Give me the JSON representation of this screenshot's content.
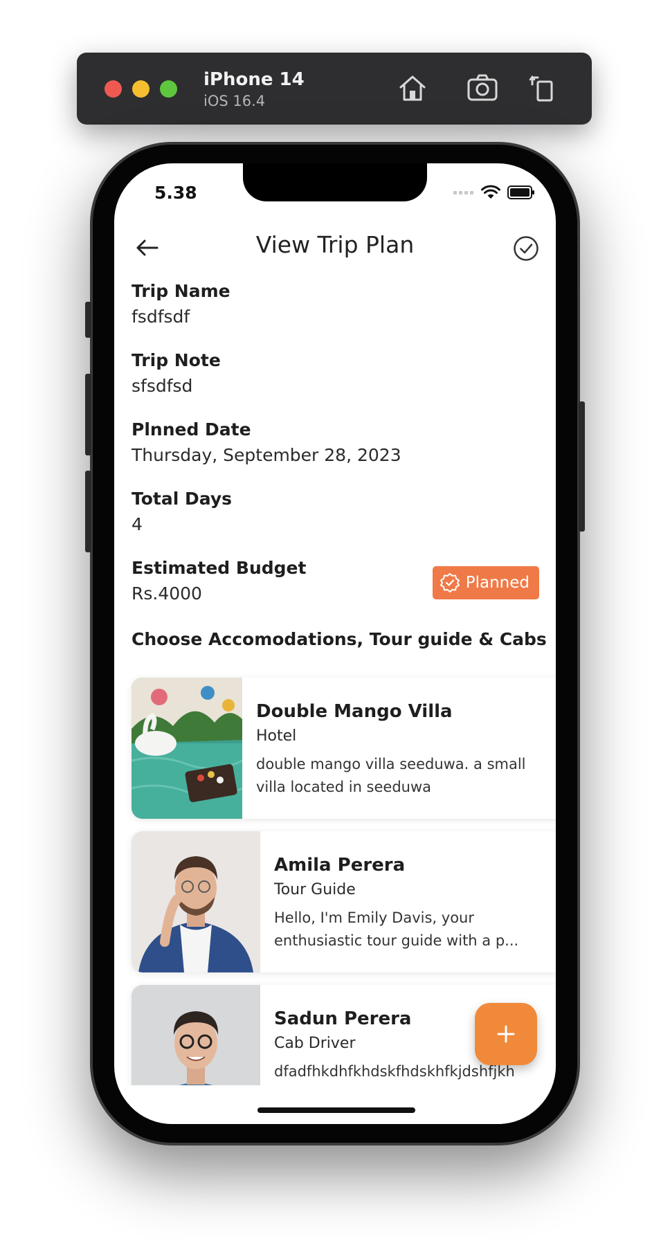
{
  "simulator": {
    "device_name": "iPhone 14",
    "os_version": "iOS 16.4",
    "icons": [
      "home-icon",
      "screenshot-icon",
      "rotate-icon"
    ]
  },
  "status_bar": {
    "time": "5.38"
  },
  "header": {
    "title": "View Trip Plan"
  },
  "fields": [
    {
      "label": "Trip Name",
      "value": "fsdfsdf"
    },
    {
      "label": "Trip Note",
      "value": "sfsdfsd"
    },
    {
      "label": "Plnned Date",
      "value": "Thursday, September 28, 2023"
    },
    {
      "label": "Total Days",
      "value": "4"
    },
    {
      "label": "Estimated Budget",
      "value": "Rs.4000"
    }
  ],
  "badge": {
    "label": "Planned"
  },
  "section_title": "Choose Accomodations, Tour guide & Cabs",
  "cards": [
    {
      "name": "Double Mango Villa",
      "type": "Hotel",
      "description": "double mango villa seeduwa. a small villa located in seeduwa"
    },
    {
      "name": "Amila Perera",
      "type": "Tour Guide",
      "description_line1": "Hello, I'm Emily Davis, your",
      "description_line2": "enthusiastic tour guide with a p..."
    },
    {
      "name": "Sadun Perera",
      "type": "Cab Driver",
      "description": "dfadfhkdhfkhdskfhdskhfkjdshfjkh"
    }
  ],
  "fab": {
    "icon": "plus-icon"
  },
  "colors": {
    "accent": "#ef7a48",
    "fab": "#f08a3a"
  }
}
